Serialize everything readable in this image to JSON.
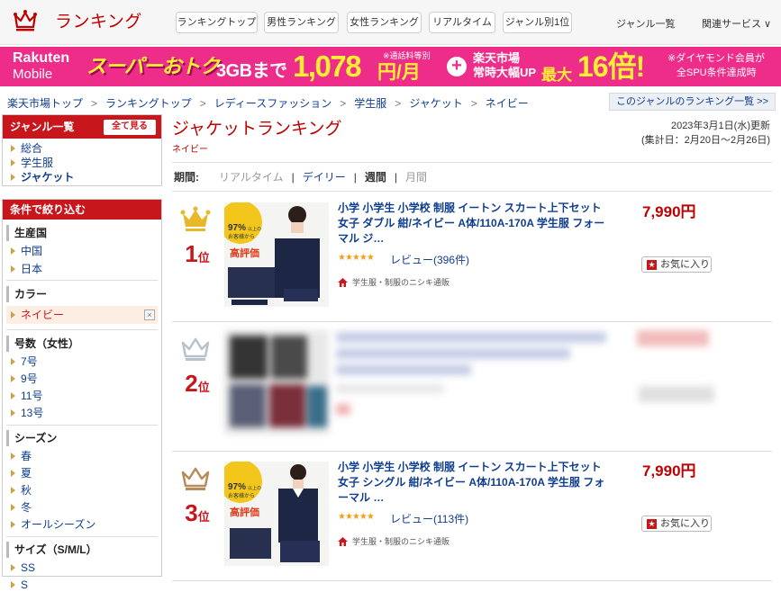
{
  "header": {
    "brand_title": "ランキング",
    "nav_pills": [
      "ランキングトップ",
      "男性ランキング",
      "女性ランキング",
      "リアルタイム",
      "ジャンル別1位"
    ],
    "genre_link": "ジャンル一覧",
    "related_link": "関連サービス ∨"
  },
  "banner": {
    "rakuten": "Rakuten",
    "mobile": "Mobile",
    "super": "スーパーおトク",
    "gb": "3GBまで",
    "price": "1,078",
    "unit": "円/月",
    "note": "※通話料等別",
    "plus": "+",
    "market1": "楽天市場",
    "market2": "常時大幅UP",
    "max": "最大",
    "big": "16倍!",
    "note2a": "※ダイヤモンド会員が",
    "note2b": "全SPU条件達成時"
  },
  "breadcrumb": [
    "楽天市場トップ",
    "ランキングトップ",
    "レディースファッション",
    "学生服",
    "ジャケット",
    "ネイビー"
  ],
  "genre_list_button": "このジャンルのランキング一覧 >>",
  "sidebar": {
    "genre_header": "ジャンル一覧",
    "see_all": "全て見る",
    "genres": [
      "総合",
      "学生服",
      "ジャケット"
    ],
    "filter_header": "条件で絞り込む",
    "origin": {
      "label": "生産国",
      "items": [
        "中国",
        "日本"
      ]
    },
    "color": {
      "label": "カラー",
      "selected": "ネイビー",
      "clear": "×"
    },
    "size_women": {
      "label": "号数（女性）",
      "items": [
        "7号",
        "9号",
        "11号",
        "13号"
      ]
    },
    "season": {
      "label": "シーズン",
      "items": [
        "春",
        "夏",
        "秋",
        "冬",
        "オールシーズン"
      ]
    },
    "size": {
      "label": "サイズ（S/M/L）",
      "items": [
        "SS",
        "S"
      ]
    }
  },
  "main": {
    "title": "ジャケットランキング",
    "subtitle": "ネイビー",
    "updated": "2023年3月1日(水)更新",
    "period_range": "(集計日：2月20日～2月26日)",
    "period_label": "期間:",
    "periods": [
      "リアルタイム",
      "デイリー",
      "週間",
      "月間"
    ],
    "current_period": "週間"
  },
  "items": [
    {
      "rank": "1",
      "rank_suffix": "位",
      "crown_color": "#e8b82b",
      "title": "小学 小学生 小学校 制服 イートン スカート上下セット 女子 ダブル 紺/ネイビー A体/110A-170A 学生服 フォーマル ジ…",
      "price": "7,990円",
      "stars": "★★★★★",
      "review": "レビュー(396件)",
      "shop": "学生服・制服のニシキ通販",
      "fav": "お気に入り",
      "badge_pct": "97%",
      "badge_t1": "以上の",
      "badge_t2": "お客様から",
      "badge_t3": "高評価"
    },
    {
      "rank": "2",
      "rank_suffix": "位",
      "crown_color": "#b8c2cc"
    },
    {
      "rank": "3",
      "rank_suffix": "位",
      "crown_color": "#b88c5a",
      "title": "小学 小学生 小学校 制服 イートン スカート上下セット 女子 シングル 紺/ネイビー A体/110A-170A 学生服 フォーマル …",
      "price": "7,990円",
      "stars": "★★★★★",
      "review": "レビュー(113件)",
      "shop": "学生服・制服のニシキ通販",
      "fav": "お気に入り",
      "badge_pct": "97%",
      "badge_t1": "以上の",
      "badge_t2": "お客様から",
      "badge_t3": "高評価"
    }
  ]
}
